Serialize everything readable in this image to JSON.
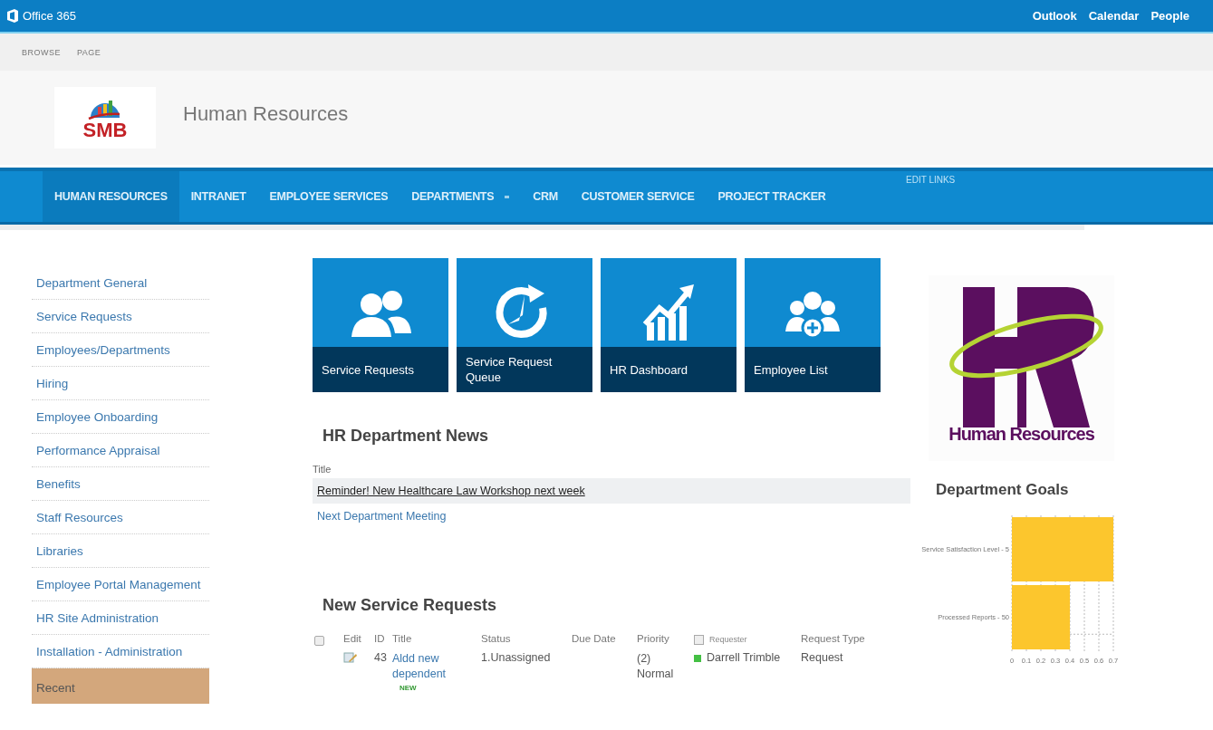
{
  "suite_bar": {
    "brand": "Office 365",
    "links": [
      "Outlook",
      "Calendar",
      "People"
    ]
  },
  "ribbon": {
    "tabs": [
      "BROWSE",
      "PAGE"
    ]
  },
  "site": {
    "title": "Human Resources",
    "logo_text": "SMB"
  },
  "top_nav": {
    "items": [
      {
        "label": "HUMAN RESOURCES",
        "selected": true
      },
      {
        "label": "INTRANET",
        "selected": false
      },
      {
        "label": "EMPLOYEE SERVICES",
        "selected": false
      },
      {
        "label": "DEPARTMENTS",
        "selected": false,
        "has_menu": true
      },
      {
        "label": "CRM",
        "selected": false
      },
      {
        "label": "CUSTOMER SERVICE",
        "selected": false
      },
      {
        "label": "PROJECT TRACKER",
        "selected": false
      }
    ],
    "edit_links": "EDIT LINKS"
  },
  "sidebar": {
    "items": [
      {
        "label": "Department General",
        "kind": "link"
      },
      {
        "label": "Service Requests",
        "kind": "link"
      },
      {
        "label": "Employees/Departments",
        "kind": "link"
      },
      {
        "label": "Hiring",
        "kind": "link"
      },
      {
        "label": "Employee Onboarding",
        "kind": "link"
      },
      {
        "label": "Performance Appraisal",
        "kind": "link"
      },
      {
        "label": "Benefits",
        "kind": "link"
      },
      {
        "label": "Staff Resources",
        "kind": "link"
      },
      {
        "label": "Libraries",
        "kind": "link"
      },
      {
        "label": "Employee Portal Management",
        "kind": "link"
      },
      {
        "label": "HR Site Administration",
        "kind": "link"
      },
      {
        "label": "Installation - Administration",
        "kind": "link"
      },
      {
        "label": "Recent",
        "kind": "header"
      }
    ]
  },
  "tiles": [
    {
      "label": "Service Requests",
      "kind": "people"
    },
    {
      "label": "Service Request Queue",
      "kind": "clock"
    },
    {
      "label": "HR Dashboard",
      "kind": "growth"
    },
    {
      "label": "Employee List",
      "kind": "group-add"
    }
  ],
  "news": {
    "heading": "HR Department News",
    "column": "Title",
    "items": [
      {
        "title": "Reminder! New Healthcare Law Workshop next week",
        "selected": true
      },
      {
        "title": "Next Department Meeting",
        "selected": false
      }
    ]
  },
  "requests": {
    "heading": "New Service Requests",
    "select_all_checked": false,
    "columns": [
      "Edit",
      "ID",
      "Title",
      "Status",
      "Due Date",
      "Priority",
      "Requester",
      "Request Type"
    ],
    "rows": [
      {
        "id": "43",
        "title": "Aldd new dependent",
        "badge": "NEW",
        "status": "1.Unassigned",
        "priority": "(2) Normal",
        "requester": "Darrell Trimble",
        "color": "#44c044",
        "request_type": "Request"
      }
    ]
  },
  "right": {
    "logo_title": "Human Resources",
    "goals_heading": "Department Goals",
    "chart_data": {
      "type": "bar",
      "orientation": "horizontal",
      "categories": [
        "Service Satisfaction Level - 5",
        "Processed Reports - 50"
      ],
      "series": [
        {
          "color": "#fcc62d",
          "values": [
            0.7,
            0.4
          ]
        }
      ],
      "grid": true,
      "xlim": [
        0,
        0.7
      ],
      "xticks": [
        0,
        0.1,
        0.2,
        0.3,
        0.4,
        0.5,
        0.6,
        0.7
      ]
    }
  }
}
